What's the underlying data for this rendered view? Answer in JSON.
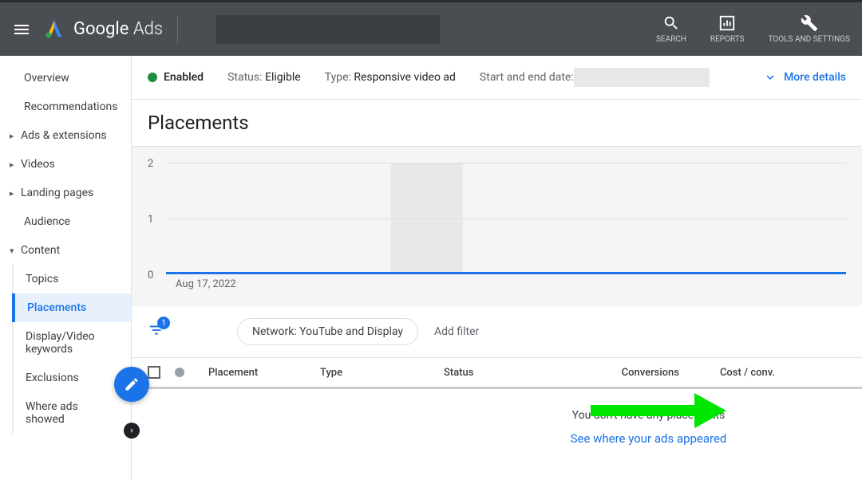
{
  "header": {
    "app_name": "Google",
    "app_suffix": "Ads",
    "search_label": "SEARCH",
    "reports_label": "REPORTS",
    "tools_label": "TOOLS AND SETTINGS"
  },
  "sidebar": {
    "items": [
      {
        "label": "Overview"
      },
      {
        "label": "Recommendations"
      },
      {
        "label": "Ads & extensions",
        "hasArrow": true
      },
      {
        "label": "Videos",
        "hasArrow": true
      },
      {
        "label": "Landing pages",
        "hasArrow": true
      },
      {
        "label": "Audience"
      },
      {
        "label": "Content",
        "expanded": true
      }
    ],
    "subItems": [
      {
        "label": "Topics"
      },
      {
        "label": "Placements",
        "active": true
      },
      {
        "label": "Display/Video keywords"
      },
      {
        "label": "Exclusions"
      },
      {
        "label": "Where ads showed"
      }
    ]
  },
  "infoBar": {
    "enabled": "Enabled",
    "status_label": "Status:",
    "status_value": "Eligible",
    "type_label": "Type:",
    "type_value": "Responsive video ad",
    "date_label": "Start and end date:",
    "more_details": "More details"
  },
  "page": {
    "title": "Placements"
  },
  "chart_data": {
    "type": "line",
    "categories": [
      "Aug 17, 2022"
    ],
    "values": [
      0
    ],
    "ylim": [
      0,
      2
    ],
    "yticks": [
      0,
      1,
      2
    ],
    "xlabel": "Aug 17, 2022"
  },
  "filter": {
    "badge": "1",
    "chip": "Network: YouTube and Display",
    "add": "Add filter"
  },
  "table": {
    "columns": [
      "Placement",
      "Type",
      "Status",
      "Conversions",
      "Cost / conv."
    ]
  },
  "empty": {
    "text": "You don't have any placements",
    "link": "See where your ads appeared"
  }
}
